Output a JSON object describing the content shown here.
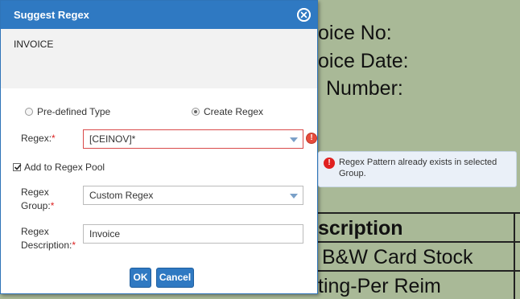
{
  "dialog": {
    "title": "Suggest Regex",
    "preview_text": "INVOICE",
    "regex_type": {
      "option_predefined": "Pre-defined Type",
      "option_create": "Create Regex",
      "selected": "Create Regex"
    },
    "regex": {
      "label": "Regex:",
      "required_mark": "*",
      "value": "[CEINOV]*"
    },
    "add_to_pool": {
      "label": "Add to Regex Pool",
      "checked": true
    },
    "regex_group": {
      "label_line1": "Regex",
      "label_line2": "Group:",
      "required_mark": "*",
      "value": "Custom Regex"
    },
    "regex_description": {
      "label_line1": "Regex",
      "label_line2": "Description:",
      "required_mark": "*",
      "value": "Invoice"
    },
    "buttons": {
      "ok": "OK",
      "cancel": "Cancel"
    }
  },
  "error_tooltip": {
    "message": "Regex Pattern already exists in selected Group."
  },
  "background_document": {
    "lines": [
      "oice No:",
      "oice Date:",
      "Number:"
    ],
    "table_lines": [
      "scription",
      "B&W Card Stock",
      "ting-Per Reim"
    ]
  },
  "colors": {
    "accent": "#2f79c2",
    "error": "#e74c3c",
    "doc_background": "#a9b997"
  }
}
